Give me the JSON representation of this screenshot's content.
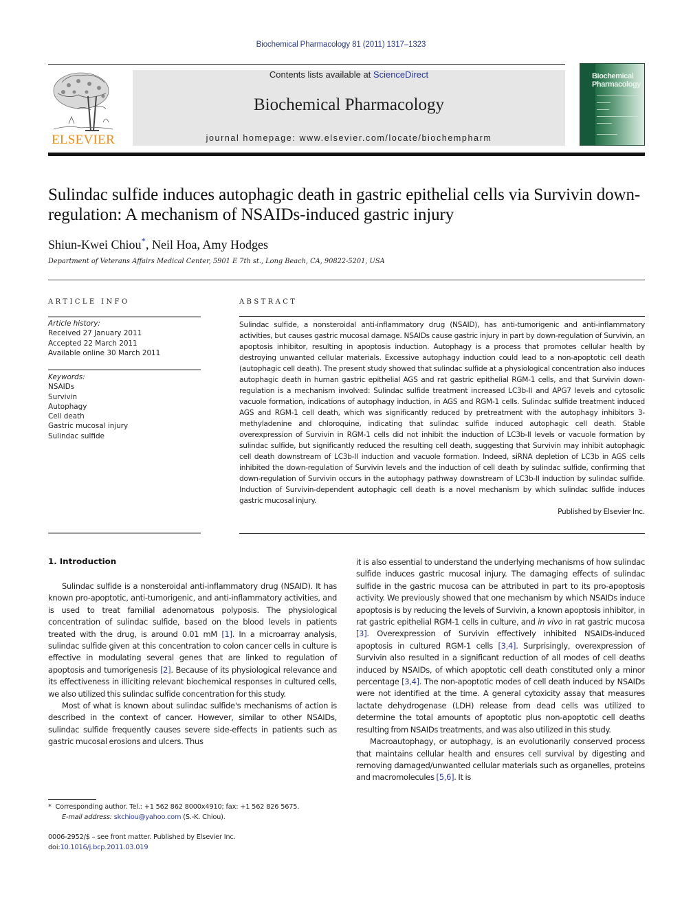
{
  "header": {
    "citation": "Biochemical Pharmacology 81 (2011) 1317–1323",
    "contents_prefix": "Contents lists available at ",
    "contents_link": "ScienceDirect",
    "journal_name": "Biochemical Pharmacology",
    "homepage": "journal homepage: www.elsevier.com/locate/biochempharm",
    "publisher_logo_text": "ELSEVIER",
    "cover_title_line1": "Biochemical",
    "cover_title_line2": "Pharmacology"
  },
  "article": {
    "title": "Sulindac sulfide induces autophagic death in gastric epithelial cells via Survivin down-regulation: A mechanism of NSAIDs-induced gastric injury",
    "authors": [
      {
        "name": "Shiun-Kwei Chiou",
        "mark": "*"
      },
      {
        "name": "Neil Hoa",
        "mark": ""
      },
      {
        "name": "Amy Hodges",
        "mark": ""
      }
    ],
    "author_sep": ", ",
    "affiliation": "Department of Veterans Affairs Medical Center, 5901 E 7th st., Long Beach, CA, 90822-5201, USA"
  },
  "article_info": {
    "heading": "ARTICLE INFO",
    "history_label": "Article history:",
    "received": "Received 27 January 2011",
    "accepted": "Accepted 22 March 2011",
    "online": "Available online 30 March 2011",
    "keywords_label": "Keywords:",
    "keywords": [
      "NSAIDs",
      "Survivin",
      "Autophagy",
      "Cell death",
      "Gastric mucosal injury",
      "Sulindac sulfide"
    ]
  },
  "abstract": {
    "heading": "ABSTRACT",
    "text": "Sulindac sulfide, a nonsteroidal anti-inflammatory drug (NSAID), has anti-tumorigenic and anti-inflammatory activities, but causes gastric mucosal damage. NSAIDs cause gastric injury in part by down-regulation of Survivin, an apoptosis inhibitor, resulting in apoptosis induction. Autophagy is a process that promotes cellular health by destroying unwanted cellular materials. Excessive autophagy induction could lead to a non-apoptotic cell death (autophagic cell death). The present study showed that sulindac sulfide at a physiological concentration also induces autophagic death in human gastric epithelial AGS and rat gastric epithelial RGM-1 cells, and that Survivin down-regulation is a mechanism involved: Sulindac sulfide treatment increased LC3b-II and APG7 levels and cytosolic vacuole formation, indications of autophagy induction, in AGS and RGM-1 cells. Sulindac sulfide treatment induced AGS and RGM-1 cell death, which was significantly reduced by pretreatment with the autophagy inhibitors 3-methyladenine and chloroquine, indicating that sulindac sulfide induced autophagic cell death. Stable overexpression of Survivin in RGM-1 cells did not inhibit the induction of LC3b-II levels or vacuole formation by sulindac sulfide, but significantly reduced the resulting cell death, suggesting that Survivin may inhibit autophagic cell death downstream of LC3b-II induction and vacuole formation. Indeed, siRNA depletion of LC3b in AGS cells inhibited the down-regulation of Survivin levels and the induction of cell death by sulindac sulfide, confirming that down-regulation of Survivin occurs in the autophagy pathway downstream of LC3b-II induction by sulindac sulfide. Induction of Survivin-dependent autophagic cell death is a novel mechanism by which sulindac sulfide induces gastric mucosal injury.",
    "publisher_note": "Published by Elsevier Inc."
  },
  "body": {
    "intro_heading": "1. Introduction",
    "p1": [
      {
        "t": "Sulindac sulfide is a nonsteroidal anti-inflammatory drug (NSAID). It has known pro-apoptotic, anti-tumorigenic, and anti-inflammatory activities, and is used to treat familial adenomatous polyposis. The physiological concentration of sulindac sulfide, based on the blood levels in patients treated with the drug, is around 0.01 mM "
      },
      {
        "ref": "[1]"
      },
      {
        "t": ". In a microarray analysis, sulindac sulfide given at this concentration to colon cancer cells in culture is effective in modulating several genes that are linked to regulation of apoptosis and tumorigenesis "
      },
      {
        "ref": "[2]"
      },
      {
        "t": ". Because of its physiological relevance and its effectiveness in illiciting relevant biochemical responses in cultured cells, we also utilized this sulindac sulfide concentration for this study."
      }
    ],
    "p2": "Most of what is known about sulindac sulfide's mechanisms of action is described in the context of cancer. However, similar to other NSAIDs, sulindac sulfide frequently causes severe side-effects in patients such as gastric mucosal erosions and ulcers. Thus",
    "p3": [
      {
        "t": "it is also essential to understand the underlying mechanisms of how sulindac sulfide induces gastric mucosal injury. The damaging effects of sulindac sulfide in the gastric mucosa can be attributed in part to its pro-apoptosis activity. We previously showed that one mechanism by which NSAIDs induce apoptosis is by reducing the levels of Survivin, a known apoptosis inhibitor, in rat gastric epithelial RGM-1 cells in culture, and "
      },
      {
        "i": "in vivo"
      },
      {
        "t": " in rat gastric mucosa "
      },
      {
        "ref": "[3]"
      },
      {
        "t": ". Overexpression of Survivin effectively inhibited NSAIDs-induced apoptosis in cultured RGM-1 cells "
      },
      {
        "ref": "[3,4]"
      },
      {
        "t": ". Surprisingly, overexpression of Survivin also resulted in a significant reduction of all modes of cell deaths induced by NSAIDs, of which apoptotic cell death constituted only a minor percentage "
      },
      {
        "ref": "[3,4]"
      },
      {
        "t": ". The non-apoptotic modes of cell death induced by NSAIDs were not identified at the time. A general cytoxicity assay that measures lactate dehydrogenase (LDH) release from dead cells was utilized to determine the total amounts of apoptotic plus non-apoptotic cell deaths resulting from NSAIDs treatments, and was also utilized in this study."
      }
    ],
    "p4": [
      {
        "t": "Macroautophagy, or autophagy, is an evolutionarily conserved process that maintains cellular health and ensures cell survival by digesting and removing damaged/unwanted cellular materials such as organelles, proteins and macromolecules "
      },
      {
        "ref": "[5,6]"
      },
      {
        "t": ". It is"
      }
    ]
  },
  "footnote": {
    "mark": "*",
    "corresponding": "Corresponding author. Tel.: +1 562 862 8000x4910; fax: +1 562 826 5675.",
    "email_label": "E-mail address:",
    "email": "skchiou@yahoo.com",
    "email_suffix": " (S.-K. Chiou)."
  },
  "front_matter": {
    "issn_line": "0006-2952/$ – see front matter. Published by Elsevier Inc.",
    "doi_prefix": "doi:",
    "doi": "10.1016/j.bcp.2011.03.019"
  }
}
